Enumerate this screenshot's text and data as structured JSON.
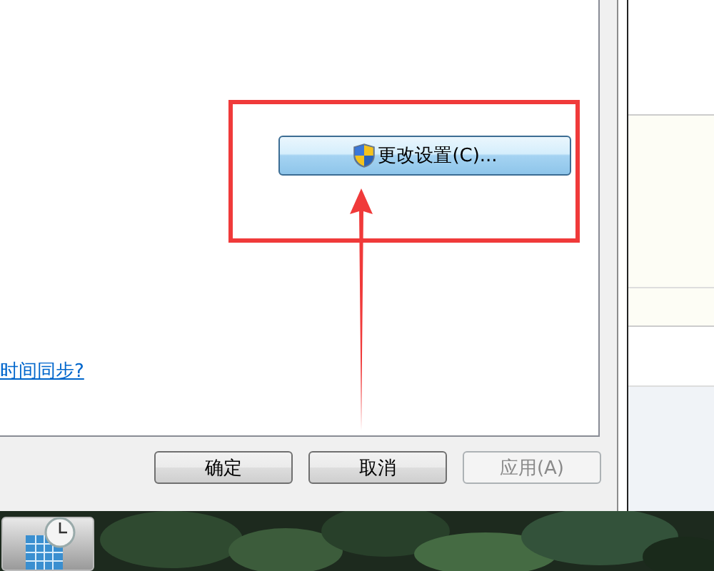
{
  "change_settings_button": {
    "label": "更改设置(C)..."
  },
  "sync_link": {
    "label": "时间同步?"
  },
  "buttons": [
    {
      "label": "确定",
      "disabled": false
    },
    {
      "label": "取消",
      "disabled": false
    },
    {
      "label": "应用(A)",
      "disabled": true
    }
  ]
}
